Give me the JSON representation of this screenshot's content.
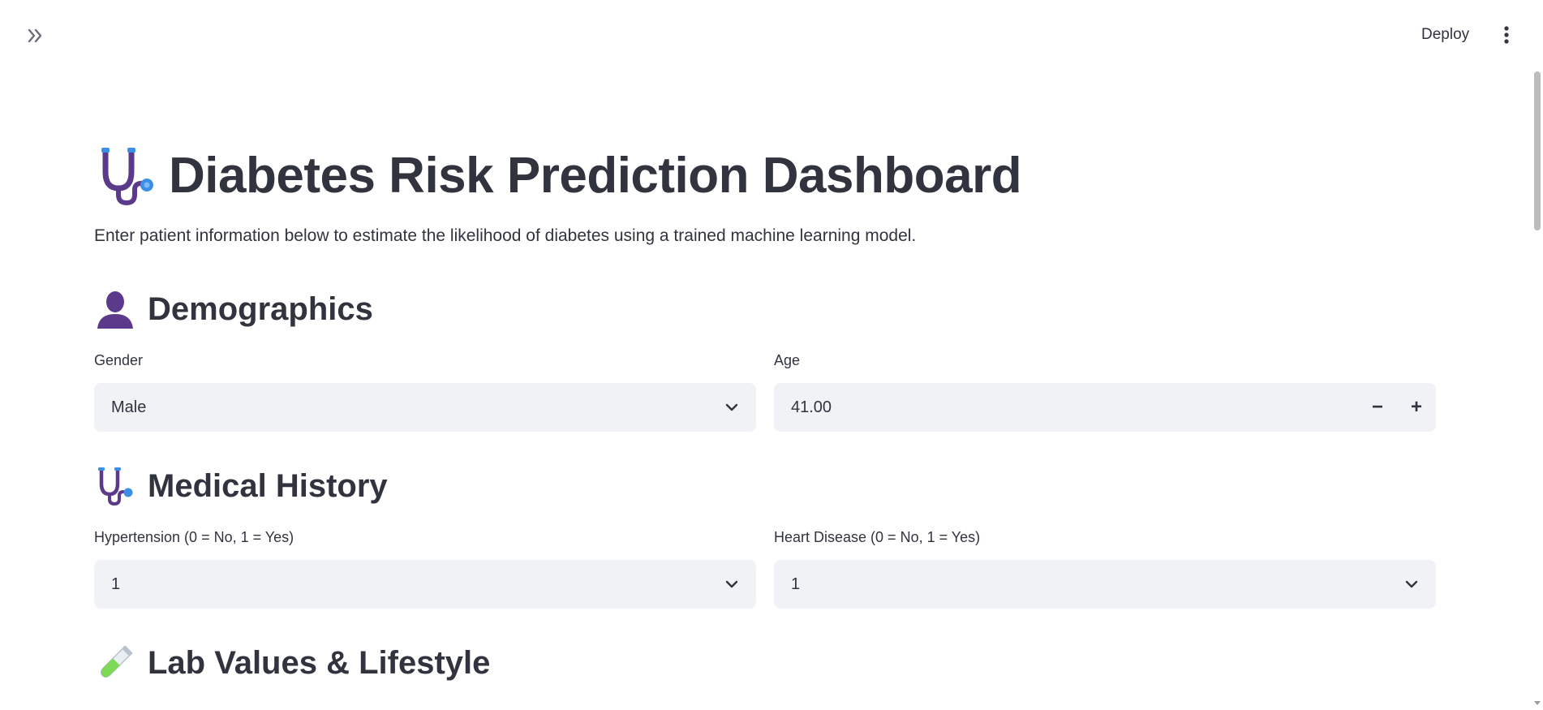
{
  "header": {
    "deploy_label": "Deploy"
  },
  "main": {
    "title": "Diabetes Risk Prediction Dashboard",
    "intro": "Enter patient information below to estimate the likelihood of diabetes using a trained machine learning model.",
    "sections": [
      {
        "title": "Demographics",
        "icon": "person-silhouette-icon",
        "fields": [
          {
            "label": "Gender",
            "value": "Male",
            "type": "select"
          },
          {
            "label": "Age",
            "value": "41.00",
            "type": "number",
            "minus": "−",
            "plus": "+"
          }
        ]
      },
      {
        "title": "Medical History",
        "icon": "stethoscope-icon",
        "fields": [
          {
            "label": "Hypertension (0 = No, 1 = Yes)",
            "value": "1",
            "type": "select"
          },
          {
            "label": "Heart Disease (0 = No, 1 = Yes)",
            "value": "1",
            "type": "select"
          }
        ]
      },
      {
        "title": "Lab Values & Lifestyle",
        "icon": "test-tube-icon"
      }
    ]
  },
  "colors": {
    "text": "#31333f",
    "input_bg": "#f0f2f6",
    "stethoscope_purple": "#5b3a8c",
    "stethoscope_blue": "#3b8fe6",
    "test_tube_green": "#7ed957"
  }
}
